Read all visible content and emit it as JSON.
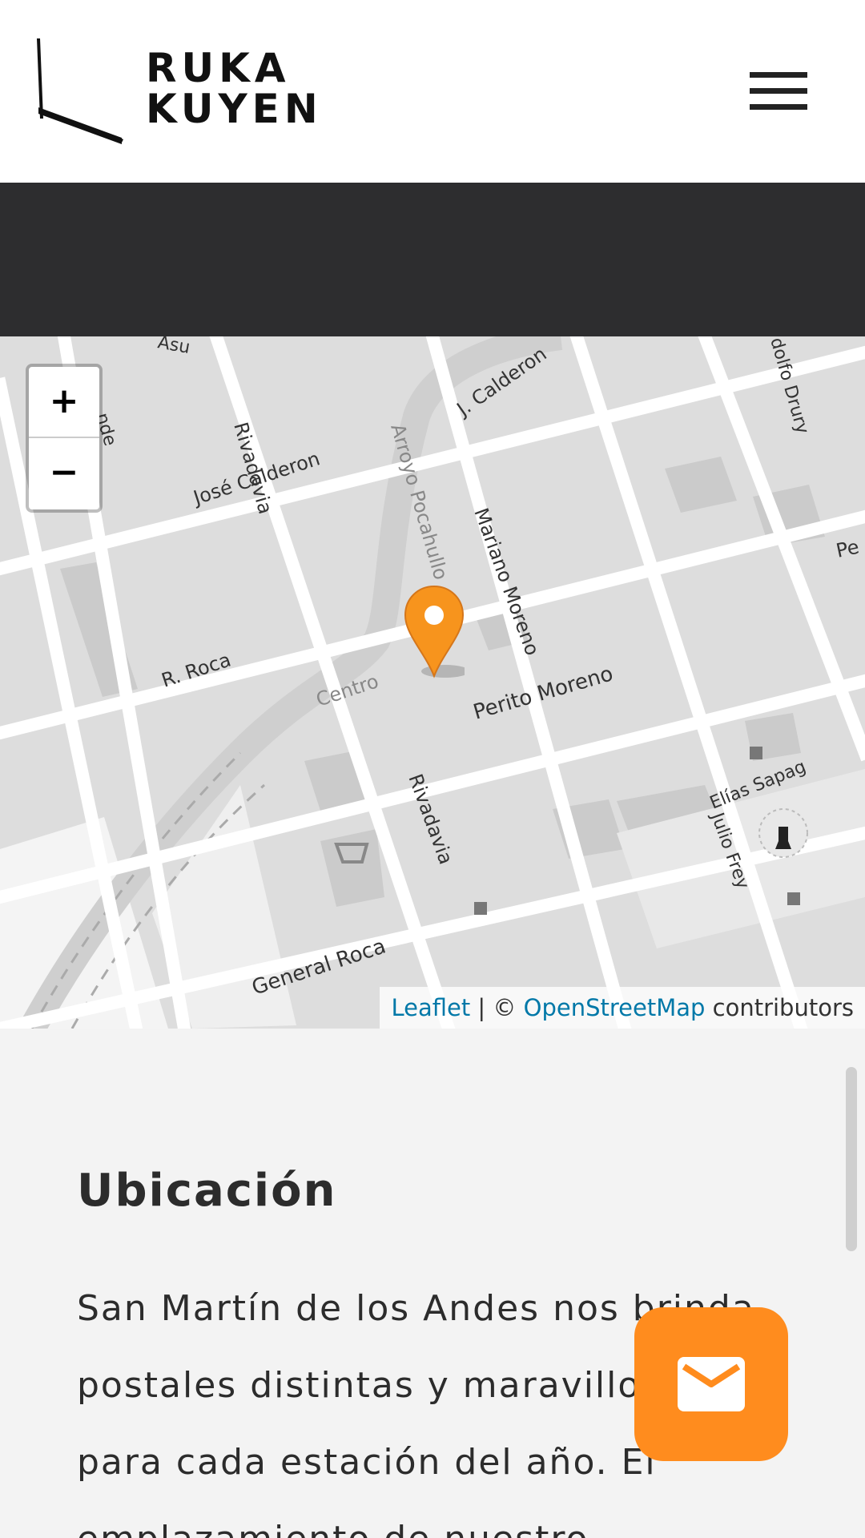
{
  "header": {
    "logo_line1": "RUKA",
    "logo_line2": "KUYEN",
    "menu_icon": "hamburger-menu-icon"
  },
  "map": {
    "zoom_in_label": "+",
    "zoom_out_label": "−",
    "marker_color": "#f7941d",
    "attribution": {
      "leaflet": "Leaflet",
      "separator": " | © ",
      "osm": "OpenStreetMap",
      "suffix": " contributors"
    },
    "street_labels": {
      "rivadavia_top": "Rivadavia",
      "jose_calderon": "José Calderon",
      "j_calderon": "J. Calderon",
      "arroyo": "Arroyo Pocahullo",
      "mariano_moreno": "Mariano Moreno",
      "r_roca": "R. Roca",
      "centro": "Centro",
      "perito_moreno": "Perito Moreno",
      "rivadavia_bottom": "Rivadavia",
      "elias_sapag": "Elías Sapag",
      "julio_frey": "Julio Frey",
      "general_roca": "General Roca",
      "drury": "dolfo Drury",
      "asu": "Asu",
      "nde": "nde",
      "pe": "Pe"
    }
  },
  "content": {
    "heading": "Ubicación",
    "line1": "San Martín de los Andes nos brinda",
    "line2": "postales distintas y maravillosas",
    "line3": "para cada estación del año. El",
    "line4": "emplazamiento de nuestro"
  },
  "fab": {
    "icon": "mail-icon",
    "color": "#ff8c1e"
  }
}
